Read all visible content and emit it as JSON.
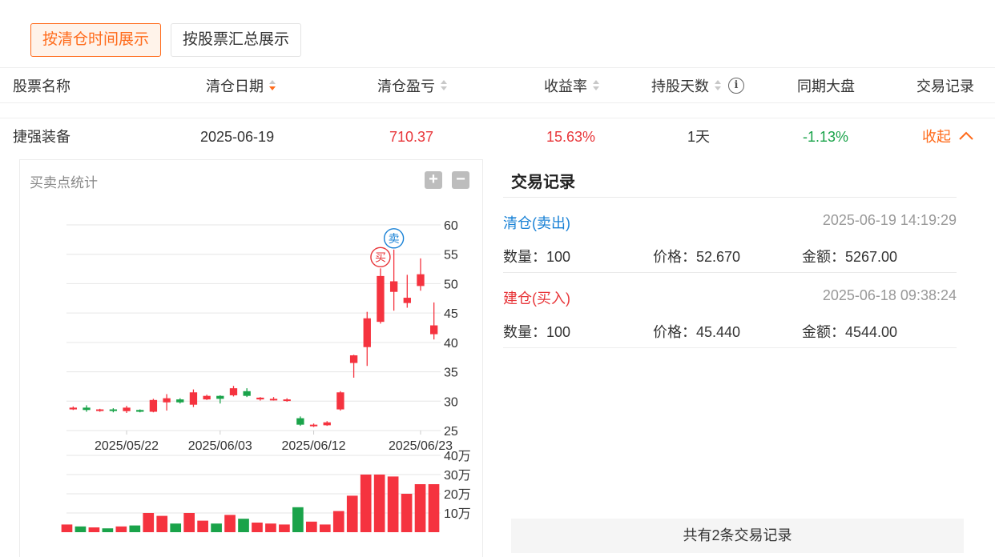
{
  "tabs": [
    {
      "label": "按清仓时间展示",
      "active": true
    },
    {
      "label": "按股票汇总展示",
      "active": false
    }
  ],
  "table": {
    "headers": {
      "name": "股票名称",
      "clear_date": "清仓日期",
      "pnl": "清仓盈亏",
      "yield": "收益率",
      "hold_days": "持股天数",
      "market": "同期大盘",
      "records": "交易记录"
    },
    "row": {
      "name": "捷强装备",
      "clear_date": "2025-06-19",
      "pnl": "710.37",
      "yield": "15.63%",
      "hold_days": "1天",
      "market": "-1.13%",
      "toggle": "收起",
      "toggle_icon": "chevron-up-icon"
    }
  },
  "chart": {
    "title": "买卖点统计",
    "zoom_in": "+",
    "zoom_out": "−",
    "buy_marker": "买",
    "sell_marker": "卖",
    "colors": {
      "up": "#f5333f",
      "down": "#1aa34a",
      "grid": "#e6e6e6",
      "buy": "#e8363a",
      "sell": "#1a82d6"
    }
  },
  "chart_data": {
    "type": "candlestick",
    "x_tick_labels": [
      "2025/05/22",
      "2025/06/03",
      "2025/06/12",
      "2025/06/23"
    ],
    "y_tick_labels": [
      "60",
      "55",
      "50",
      "45",
      "40",
      "35",
      "30",
      "25"
    ],
    "ylim": [
      25,
      60
    ],
    "volume_tick_labels": [
      "40万",
      "30万",
      "20万",
      "10万"
    ],
    "volume_lim": [
      0,
      400000
    ],
    "candles": [
      {
        "o": 28.6,
        "c": 28.9,
        "h": 29.1,
        "l": 28.5,
        "v": 40000
      },
      {
        "o": 28.9,
        "c": 28.5,
        "h": 29.3,
        "l": 28.2,
        "v": 30000
      },
      {
        "o": 28.4,
        "c": 28.6,
        "h": 28.7,
        "l": 28.2,
        "v": 25000
      },
      {
        "o": 28.6,
        "c": 28.4,
        "h": 28.8,
        "l": 28.1,
        "v": 20000
      },
      {
        "o": 28.3,
        "c": 28.9,
        "h": 29.2,
        "l": 28.0,
        "v": 30000
      },
      {
        "o": 28.5,
        "c": 28.2,
        "h": 28.6,
        "l": 28.1,
        "v": 35000
      },
      {
        "o": 28.2,
        "c": 30.2,
        "h": 30.4,
        "l": 28.1,
        "v": 100000
      },
      {
        "o": 29.8,
        "c": 30.5,
        "h": 31.2,
        "l": 28.4,
        "v": 85000
      },
      {
        "o": 30.3,
        "c": 29.8,
        "h": 30.5,
        "l": 29.6,
        "v": 45000
      },
      {
        "o": 29.4,
        "c": 31.5,
        "h": 32.0,
        "l": 29.0,
        "v": 100000
      },
      {
        "o": 30.3,
        "c": 30.9,
        "h": 31.1,
        "l": 30.2,
        "v": 60000
      },
      {
        "o": 30.9,
        "c": 30.4,
        "h": 31.0,
        "l": 29.6,
        "v": 45000
      },
      {
        "o": 31.0,
        "c": 32.2,
        "h": 32.6,
        "l": 30.8,
        "v": 90000
      },
      {
        "o": 31.7,
        "c": 30.9,
        "h": 32.2,
        "l": 30.7,
        "v": 70000
      },
      {
        "o": 30.3,
        "c": 30.6,
        "h": 30.7,
        "l": 30.1,
        "v": 50000
      },
      {
        "o": 30.3,
        "c": 30.4,
        "h": 30.7,
        "l": 30.1,
        "v": 45000
      },
      {
        "o": 30.1,
        "c": 30.3,
        "h": 30.5,
        "l": 29.9,
        "v": 40000
      },
      {
        "o": 27.1,
        "c": 26.0,
        "h": 27.4,
        "l": 25.8,
        "v": 130000
      },
      {
        "o": 25.8,
        "c": 26.0,
        "h": 26.2,
        "l": 25.6,
        "v": 55000
      },
      {
        "o": 25.9,
        "c": 26.4,
        "h": 26.6,
        "l": 25.8,
        "v": 40000
      },
      {
        "o": 28.6,
        "c": 31.5,
        "h": 31.7,
        "l": 28.4,
        "v": 110000
      },
      {
        "o": 36.5,
        "c": 37.8,
        "h": 37.9,
        "l": 34.0,
        "v": 190000
      },
      {
        "o": 39.2,
        "c": 44.1,
        "h": 45.2,
        "l": 36.0,
        "v": 300000
      },
      {
        "o": 43.5,
        "c": 51.3,
        "h": 52.6,
        "l": 43.2,
        "v": 300000
      },
      {
        "o": 48.6,
        "c": 50.4,
        "h": 55.8,
        "l": 45.4,
        "v": 290000
      },
      {
        "o": 46.7,
        "c": 47.6,
        "h": 51.5,
        "l": 45.9,
        "v": 200000
      },
      {
        "o": 49.6,
        "c": 51.6,
        "h": 54.3,
        "l": 48.8,
        "v": 250000
      },
      {
        "o": 41.4,
        "c": 42.9,
        "h": 46.8,
        "l": 40.5,
        "v": 250000
      }
    ],
    "buy_index": 23,
    "sell_index": 24
  },
  "trades": {
    "title": "交易记录",
    "records": [
      {
        "type": "清仓(卖出)",
        "time": "2025-06-19 14:19:29",
        "qty": "数量：100",
        "price": "价格：52.670",
        "amount": "金额：5267.00"
      },
      {
        "type": "建仓(买入)",
        "time": "2025-06-18 09:38:24",
        "qty": "数量：100",
        "price": "价格：45.440",
        "amount": "金额：4544.00"
      }
    ],
    "footer": "共有2条交易记录"
  }
}
